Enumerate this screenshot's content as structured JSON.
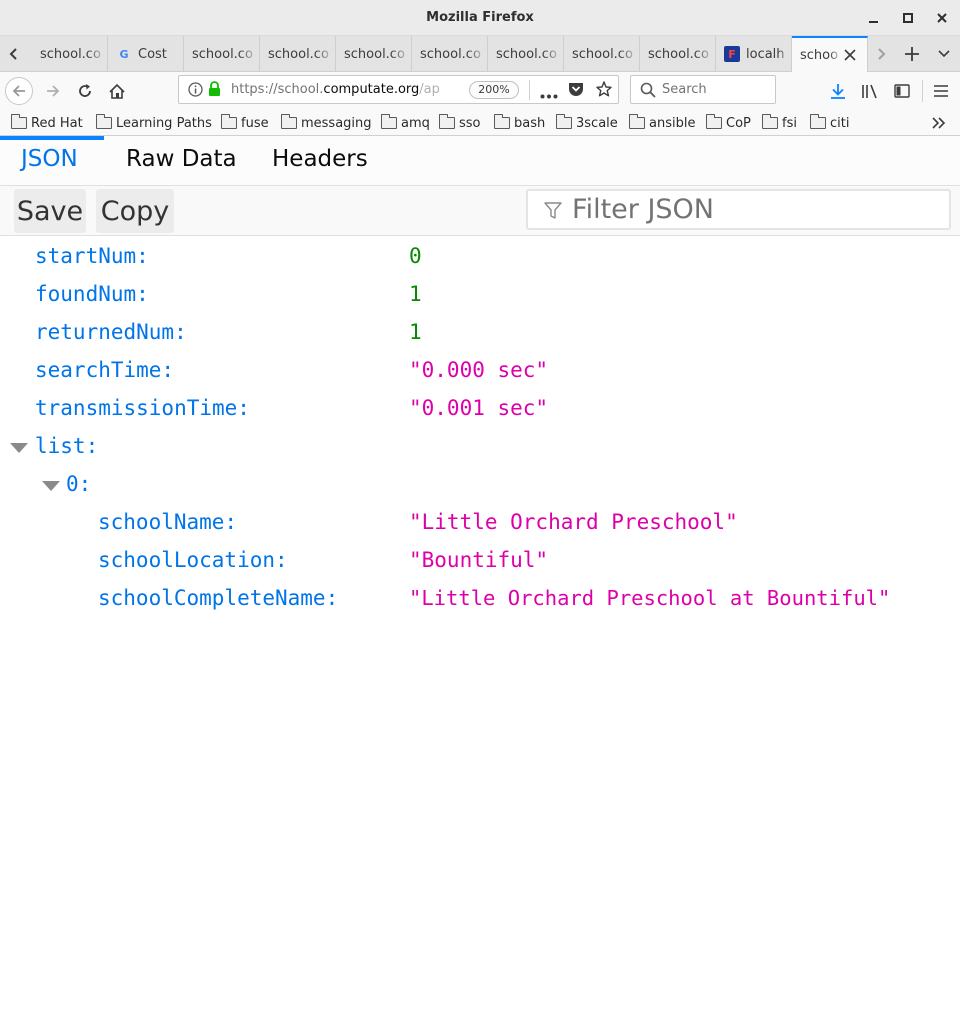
{
  "window": {
    "title": "Mozilla Firefox"
  },
  "tabs": [
    {
      "label": "school.co",
      "icon": "none"
    },
    {
      "label": "Cost",
      "icon": "google-icon"
    },
    {
      "label": "school.co",
      "icon": "none"
    },
    {
      "label": "school.co",
      "icon": "none"
    },
    {
      "label": "school.co",
      "icon": "none"
    },
    {
      "label": "school.co",
      "icon": "none"
    },
    {
      "label": "school.co",
      "icon": "none"
    },
    {
      "label": "school.co",
      "icon": "none"
    },
    {
      "label": "school.co",
      "icon": "none"
    },
    {
      "label": "localh",
      "icon": "app-icon"
    },
    {
      "label": "schoo",
      "icon": "none",
      "active": true
    }
  ],
  "navbar": {
    "url_prefix": "https://school.",
    "url_domain": "computate.org",
    "url_suffix": "/ap",
    "zoom": "200%",
    "search_placeholder": "Search"
  },
  "bookmarks": [
    "Red Hat",
    "Learning Paths",
    "fuse",
    "messaging",
    "amq",
    "sso",
    "bash",
    "3scale",
    "ansible",
    "CoP",
    "fsi",
    "citi"
  ],
  "viewer": {
    "tabs": [
      "JSON",
      "Raw Data",
      "Headers"
    ],
    "active_tab": "JSON",
    "save_label": "Save",
    "copy_label": "Copy",
    "filter_placeholder": "Filter JSON"
  },
  "json": {
    "startNum_key": "startNum:",
    "startNum_val": "0",
    "foundNum_key": "foundNum:",
    "foundNum_val": "1",
    "returnedNum_key": "returnedNum:",
    "returnedNum_val": "1",
    "searchTime_key": "searchTime:",
    "searchTime_val": "\"0.000 sec\"",
    "transmissionTime_key": "transmissionTime:",
    "transmissionTime_val": "\"0.001 sec\"",
    "list_key": "list:",
    "item0_key": "0:",
    "schoolName_key": "schoolName:",
    "schoolName_val": "\"Little Orchard Preschool\"",
    "schoolLocation_key": "schoolLocation:",
    "schoolLocation_val": "\"Bountiful\"",
    "schoolCompleteName_key": "schoolCompleteName:",
    "schoolCompleteName_val": "\"Little Orchard Preschool at Bountiful\""
  },
  "colors": {
    "accent": "#0a84ff",
    "json_key": "#0074e8",
    "json_number": "#058b00",
    "json_string": "#dd00a9"
  }
}
